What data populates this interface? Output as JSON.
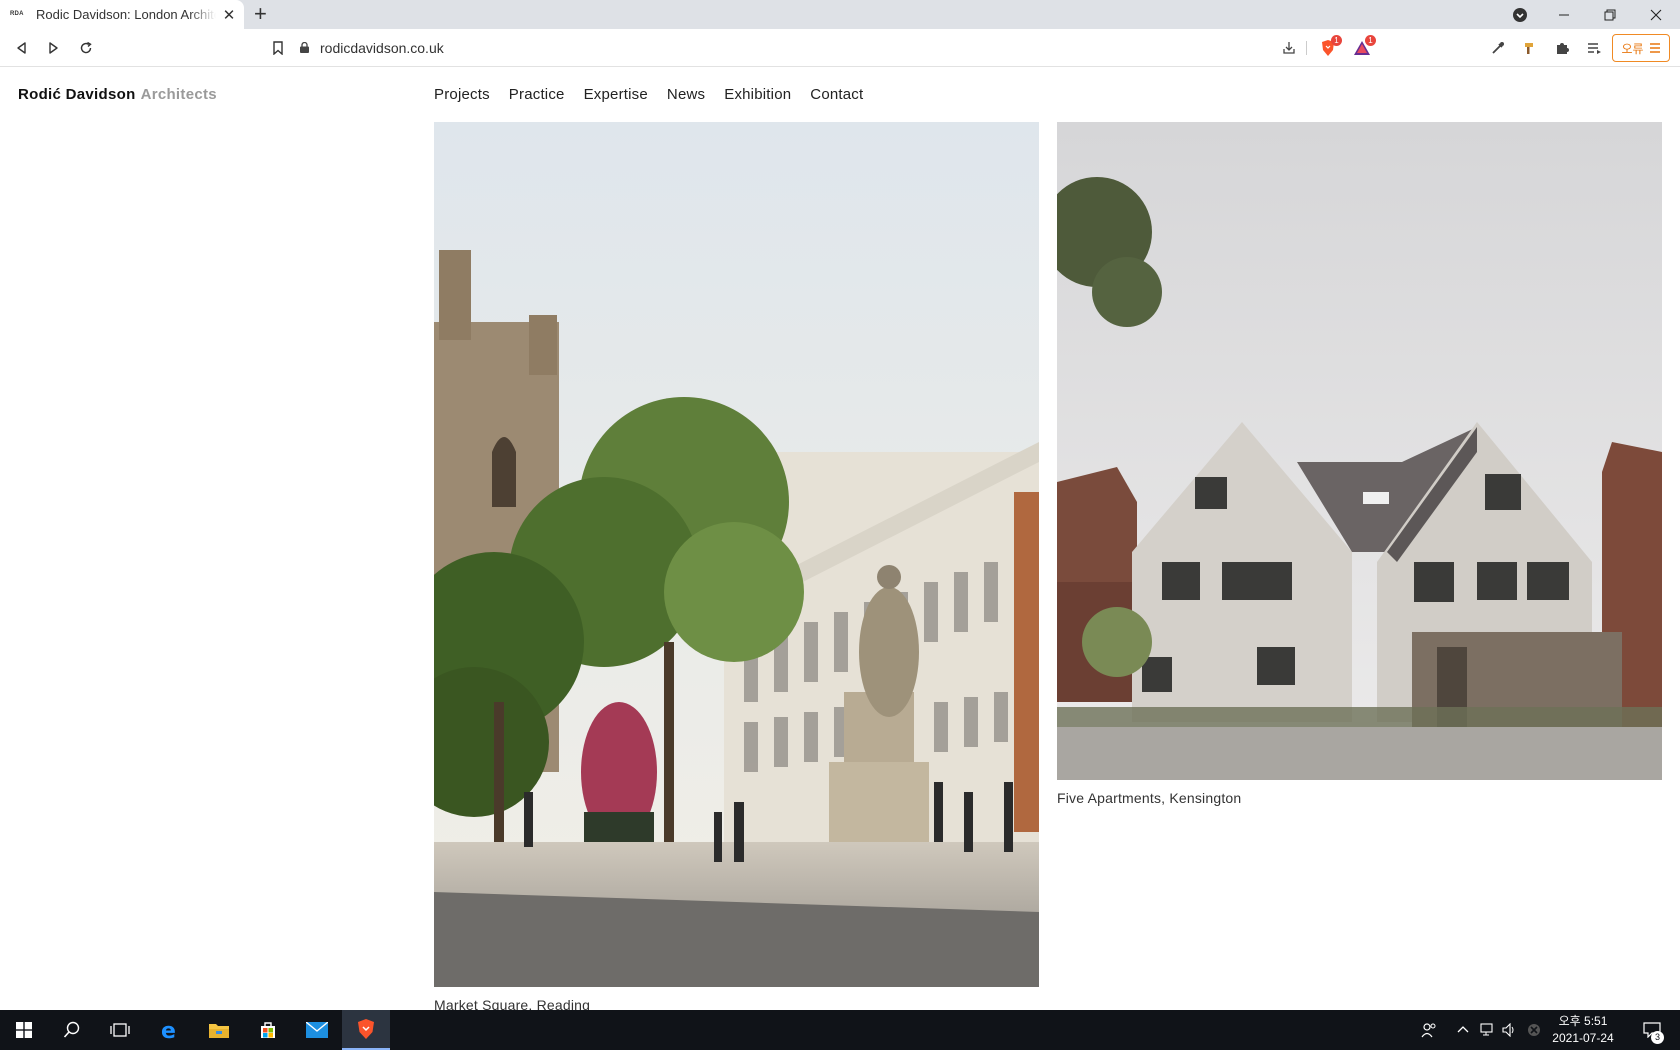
{
  "browser": {
    "tab_favicon_text": "RDA",
    "tab_title": "Rodic Davidson: London Architects",
    "url": "rodicdavidson.co.uk",
    "shields_badge": "1",
    "rewards_badge": "1",
    "error_button_label": "오류",
    "accent_color": "#f08a24"
  },
  "site": {
    "logo_bold": "Rodić Davidson",
    "logo_light": "Architects",
    "nav": [
      "Projects",
      "Practice",
      "Expertise",
      "News",
      "Exhibition",
      "Contact"
    ]
  },
  "projects": [
    {
      "caption": "Market Square, Reading",
      "image": "market-square-reading-render"
    },
    {
      "caption": "Five Apartments, Kensington",
      "image": "five-apartments-kensington-render"
    }
  ],
  "taskbar": {
    "time": "오후 5:51",
    "date": "2021-07-24",
    "notification_count": "3",
    "apps": [
      "start-icon",
      "search-icon",
      "task-view-icon",
      "edge-icon",
      "file-explorer-icon",
      "store-icon",
      "mail-icon",
      "brave-icon"
    ]
  }
}
